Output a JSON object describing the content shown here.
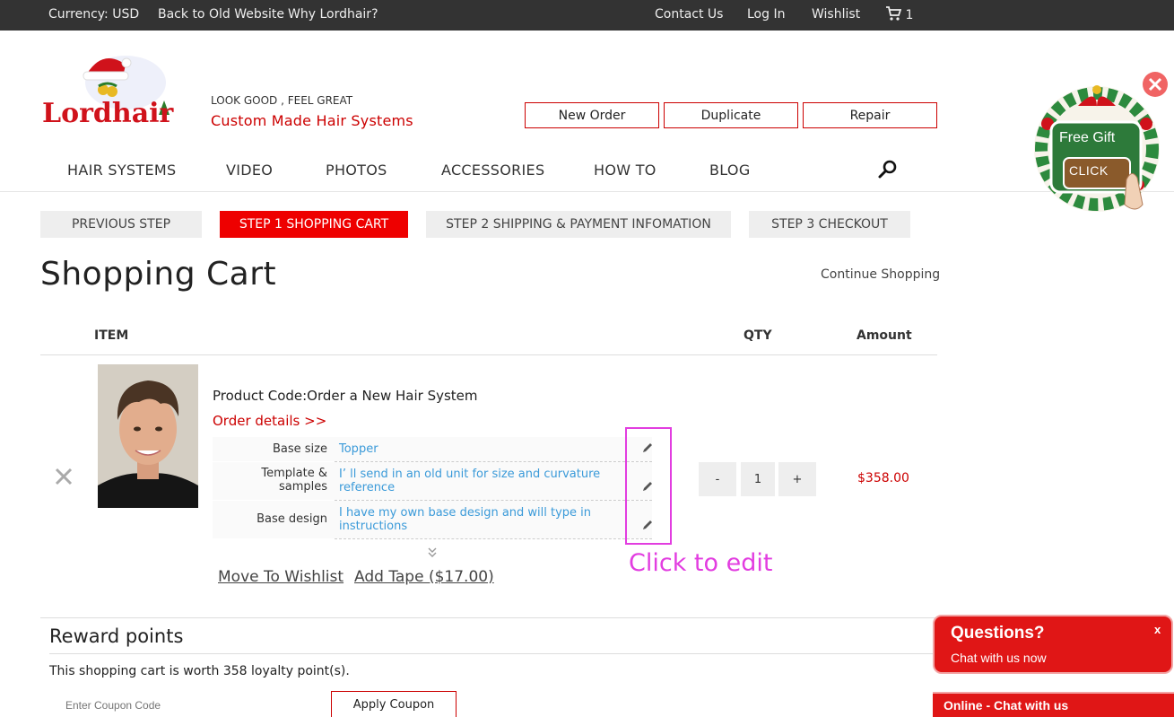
{
  "topbar": {
    "currency": "Currency:  USD",
    "old_site": "Back to Old Website",
    "why": "Why Lordhair?",
    "contact": "Contact Us",
    "login": "Log In",
    "wishlist": "Wishlist",
    "cart_count": "1"
  },
  "header": {
    "logo_text": "Lordhair",
    "tagline": "LOOK GOOD , FEEL GREAT",
    "subtitle": "Custom Made Hair Systems",
    "buttons": [
      "New Order",
      "Duplicate",
      "Repair"
    ]
  },
  "nav": [
    "HAIR SYSTEMS",
    "VIDEO",
    "PHOTOS",
    "ACCESSORIES",
    "HOW TO",
    "BLOG"
  ],
  "steps": [
    {
      "label": "PREVIOUS STEP",
      "active": false
    },
    {
      "label": "STEP 1 SHOPPING CART",
      "active": true
    },
    {
      "label": "STEP 2 SHIPPING & PAYMENT INFOMATION",
      "active": false
    },
    {
      "label": "STEP 3 CHECKOUT",
      "active": false
    }
  ],
  "page": {
    "title": "Shopping Cart",
    "continue": "Continue Shopping"
  },
  "table": {
    "item": "ITEM",
    "qty": "QTY",
    "amount": "Amount"
  },
  "product": {
    "code": "Product Code:Order a New Hair System",
    "details_link": "Order details >>",
    "options": [
      {
        "label": "Base size",
        "value": "Topper"
      },
      {
        "label": "Template & samples",
        "value": "I’ ll send in an old unit for size and curvature reference"
      },
      {
        "label": "Base design",
        "value": "I have my own base design and will type in instructions"
      }
    ],
    "move_wishlist": "Move To Wishlist",
    "add_tape": "Add Tape ($17.00)",
    "qty": "1",
    "qty_minus": "-",
    "qty_plus": "+",
    "amount": "$358.00"
  },
  "annotation": {
    "click_to_edit": "Click to edit"
  },
  "reward": {
    "title": "Reward points",
    "text": "This shopping cart is worth 358 loyalty point(s).",
    "coupon_placeholder": "Enter Coupon Code",
    "apply": "Apply Coupon"
  },
  "gift": {
    "label": "Free Gift",
    "click": "CLICK"
  },
  "chat": {
    "title": "Questions?",
    "subtitle": "Chat with us now",
    "close": "x",
    "bar": "Online - Chat with us"
  },
  "colors": {
    "accent": "#e00000",
    "link_blue": "#3a9ad9",
    "annotation": "#e23de0"
  }
}
